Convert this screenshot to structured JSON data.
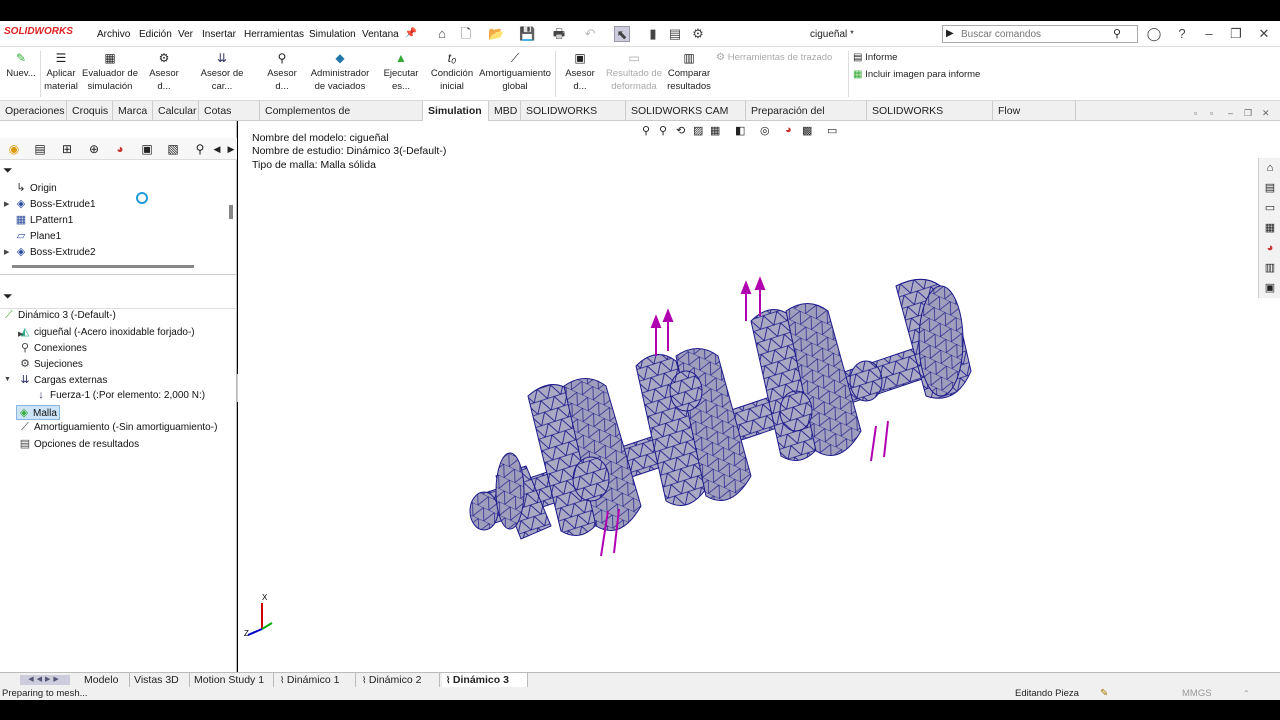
{
  "titlebar": {
    "logo": "SOLIDWORKS",
    "menus": [
      "Archivo",
      "Edición",
      "Ver",
      "Insertar",
      "Herramientas",
      "Simulation",
      "Ventana"
    ],
    "document_title": "cigueñal *",
    "search_placeholder": "Buscar comandos"
  },
  "ribbon": {
    "new": "Nuev...",
    "aplicar": [
      "Aplicar",
      "material"
    ],
    "evaluador": [
      "Evaluador de",
      "simulación"
    ],
    "asesor1": "Asesor d...",
    "asesor2": "Asesor de car...",
    "asesor3": "Asesor d...",
    "administrador": [
      "Administrador",
      "de vaciados"
    ],
    "ejecutar": "Ejecutar es...",
    "condicion": [
      "Condición",
      "inicial"
    ],
    "amortiguamiento": [
      "Amortiguamiento",
      "global"
    ],
    "asesor4": "Asesor d...",
    "resultado": [
      "Resultado de",
      "deformada"
    ],
    "comparar": [
      "Comparar",
      "resultados"
    ],
    "herramientas_trazado": "Herramientas de trazado",
    "informe": "Informe",
    "incluir_imagen": "Incluir imagen para informe"
  },
  "tabs": [
    "Operaciones",
    "Croquis",
    "Marca",
    "Calcular",
    "Cotas MBD",
    "Complementos de SOLIDWORKS",
    "Simulation",
    "MBD",
    "SOLIDWORKS CAM",
    "SOLIDWORKS CAM TBM",
    "Preparación del análisis",
    "SOLIDWORKS Inspection",
    "Flow Simulation"
  ],
  "active_tab": "Simulation",
  "feature_tree": [
    "Origin",
    "Boss-Extrude1",
    "LPattern1",
    "Plane1",
    "Boss-Extrude2"
  ],
  "study_tree": {
    "study": "Dinámico 3 (-Default-)",
    "part": "cigueñal (-Acero inoxidable forjado-)",
    "conexiones": "Conexiones",
    "sujeciones": "Sujeciones",
    "cargas": "Cargas externas",
    "fuerza": "Fuerza-1 (:Por elemento: 2,000 N:)",
    "malla": "Malla",
    "amortiguamiento": "Amortiguamiento (-Sin amortiguamiento-)",
    "opciones": "Opciones de resultados"
  },
  "graphics": {
    "modelo": "Nombre del modelo: cigueñal",
    "estudio": "Nombre de estudio: Dinámico 3(-Default-)",
    "malla": "Tipo de malla: Malla sólida",
    "axis_x": "X",
    "axis_z": "Z"
  },
  "bottom_tabs": [
    "Modelo",
    "Vistas 3D",
    "Motion Study 1",
    "Dinámico 1",
    "Dinámico 2",
    "Dinámico 3"
  ],
  "active_bottom_tab": "Dinámico 3",
  "status": {
    "left": "Preparing to mesh...",
    "mode": "Editando Pieza",
    "units": "MMGS"
  },
  "colors": {
    "mesh_fill": "#a9a8c4",
    "mesh_line": "#1a1a8c",
    "force_arrow": "#b000b0",
    "accent": "#d22"
  }
}
